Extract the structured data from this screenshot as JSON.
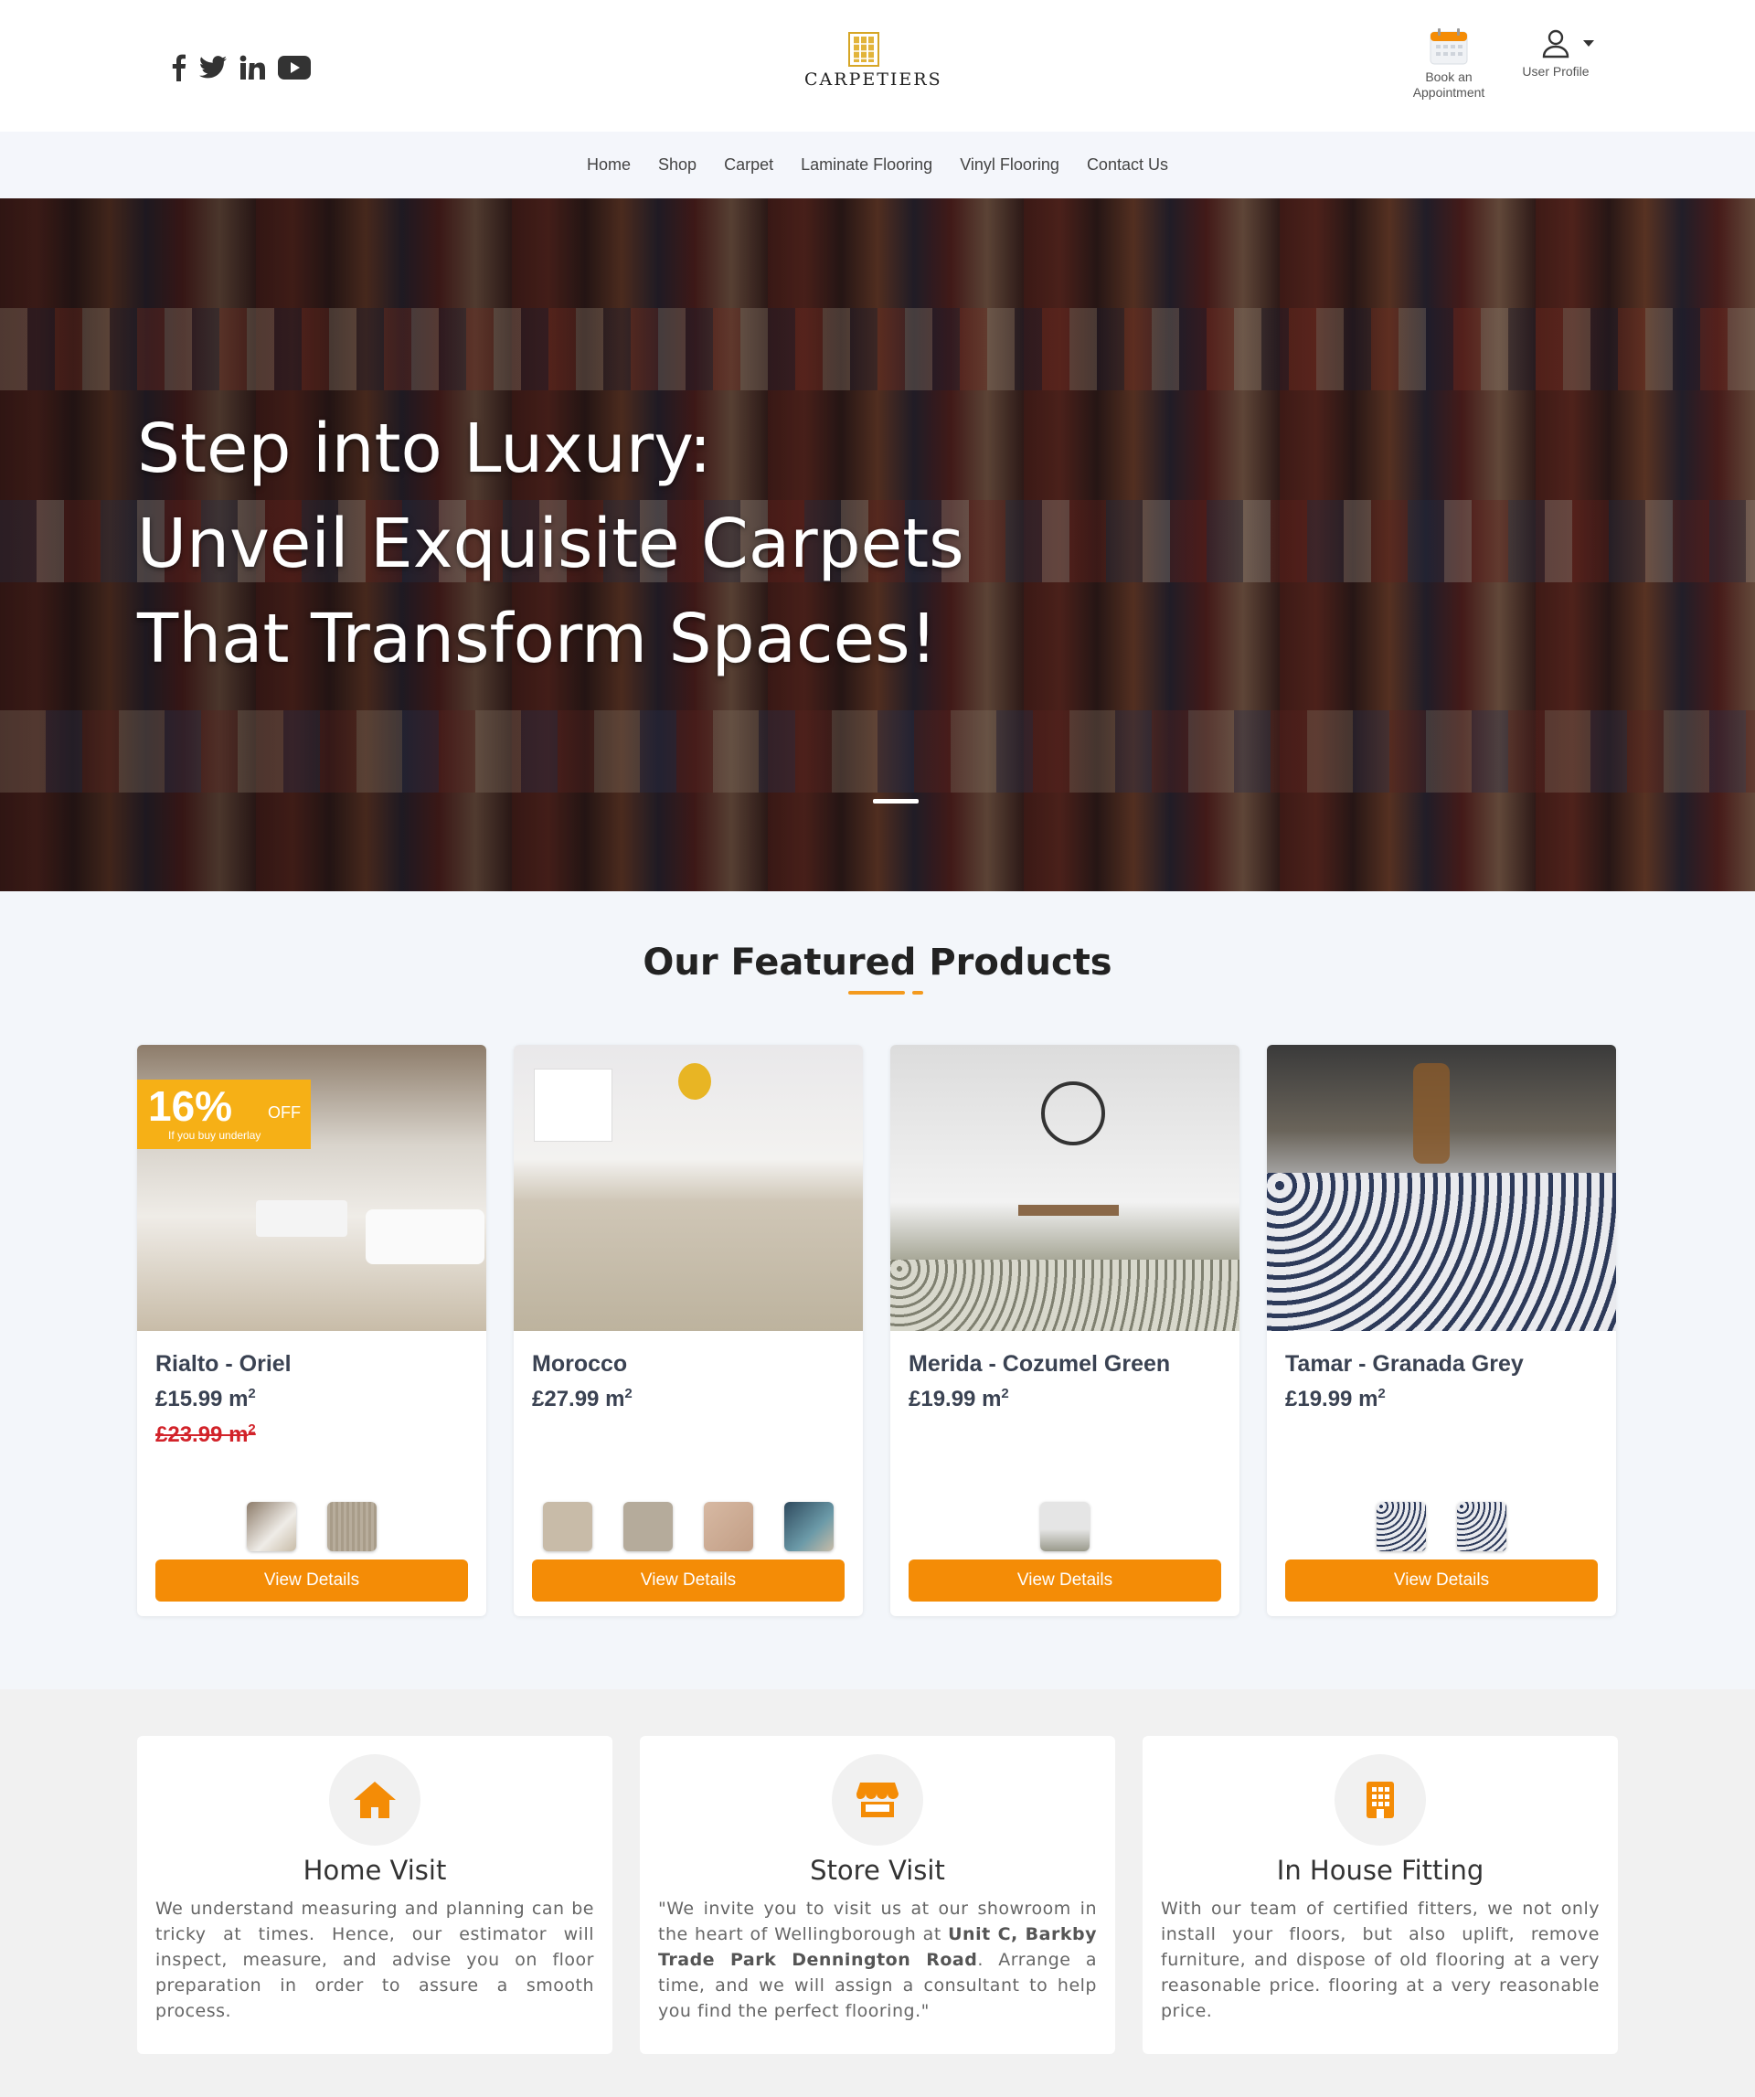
{
  "header": {
    "socials": [
      "facebook-icon",
      "twitter-icon",
      "linkedin-icon",
      "youtube-icon"
    ],
    "logo_text": "CARPETIERS",
    "book_label_1": "Book an",
    "book_label_2": "Appointment",
    "user_label": "User Profile"
  },
  "nav": [
    "Home",
    "Shop",
    "Carpet",
    "Laminate Flooring",
    "Vinyl Flooring",
    "Contact Us"
  ],
  "hero": {
    "line1": "Step into Luxury:",
    "line2": "Unveil Exquisite Carpets",
    "line3": "That Transform Spaces!"
  },
  "featured": {
    "title": "Our Featured Products",
    "products": [
      {
        "name": "Rialto - Oriel",
        "price": "£15.99 m",
        "old_price": "£23.99 m",
        "badge_pct": "16%",
        "badge_off": "OFF",
        "badge_sub": "If you buy underlay",
        "button": "View Details"
      },
      {
        "name": "Morocco",
        "price": "£27.99 m",
        "button": "View Details"
      },
      {
        "name": "Merida - Cozumel Green",
        "price": "£19.99 m",
        "button": "View Details"
      },
      {
        "name": "Tamar - Granada Grey",
        "price": "£19.99 m",
        "button": "View Details"
      }
    ]
  },
  "services": [
    {
      "title": "Home Visit",
      "text": "We understand measuring and planning can be tricky at times. Hence, our estimator will inspect, measure, and advise you on floor preparation in order to assure a smooth process."
    },
    {
      "title": "Store Visit",
      "text_a": "\"We invite you to visit us at our showroom in the heart of Wellingborough at ",
      "text_b": "Unit C, Barkby Trade Park Dennington Road",
      "text_c": ". Arrange a time, and we will assign a consultant to help you find the perfect flooring.\""
    },
    {
      "title": "In House Fitting",
      "text": "With our team of certified fitters, we not only install your floors, but also uplift, remove furniture, and dispose of old flooring at a very reasonable price. flooring at a very reasonable price."
    }
  ],
  "colors": {
    "accent": "#f48c06",
    "badge": "#f6b016",
    "sale": "#d2232a",
    "text": "#3a4252"
  }
}
